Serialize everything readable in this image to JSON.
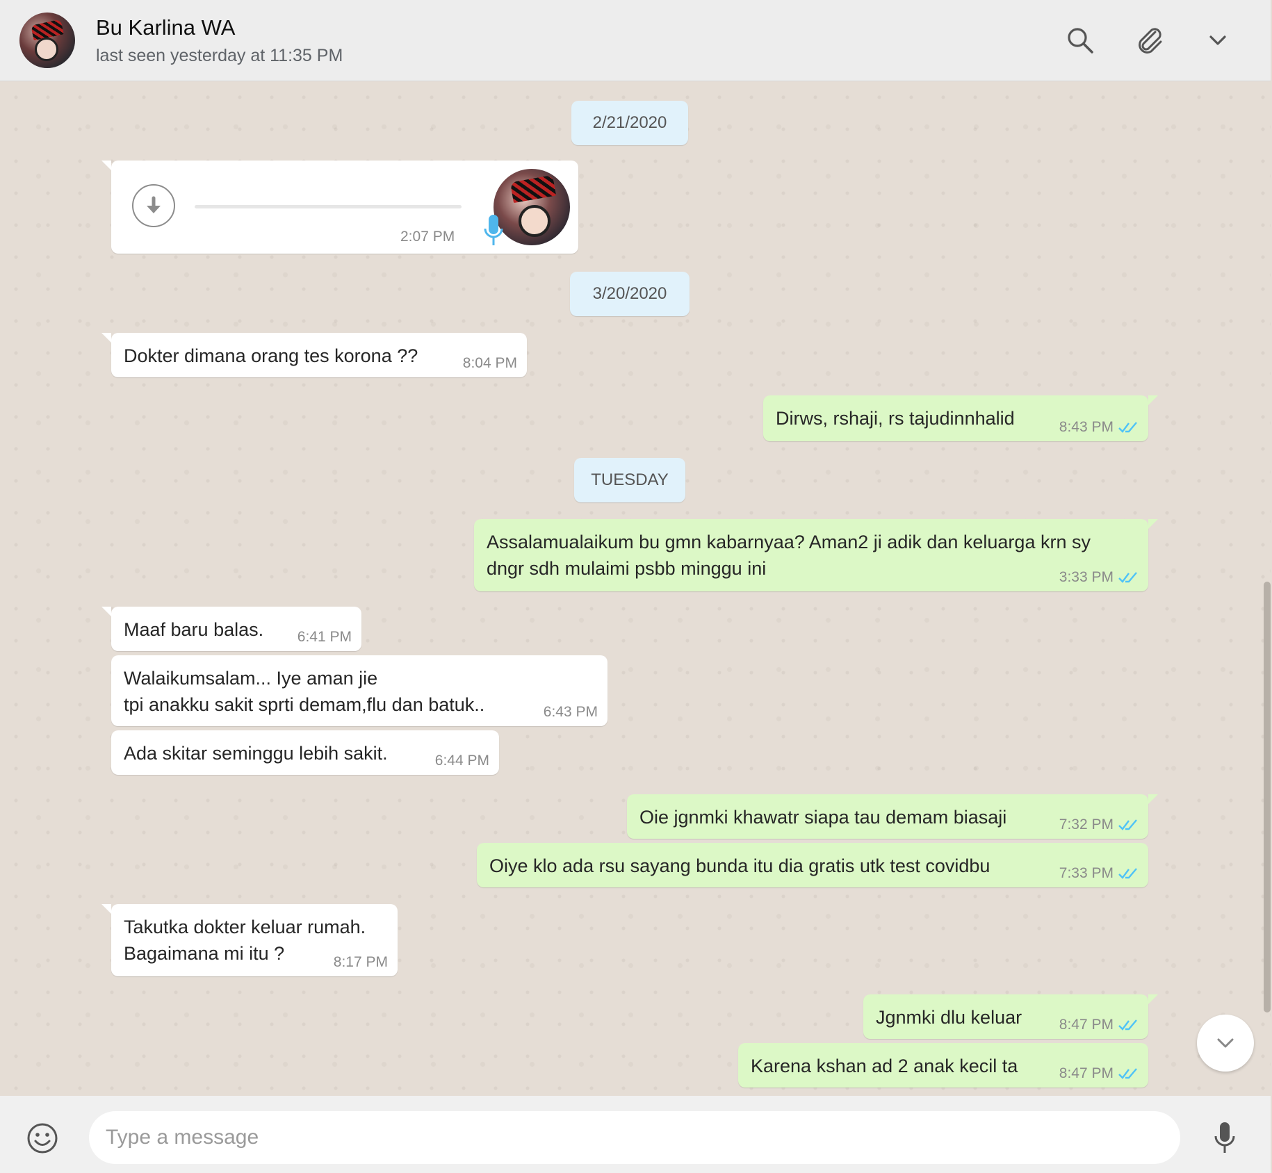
{
  "header": {
    "contact_name": "Bu Karlina WA",
    "status": "last seen yesterday at 11:35 PM",
    "icons": [
      "search-icon",
      "attach-icon",
      "chevron-down-icon"
    ]
  },
  "dates": {
    "d1": "2/21/2020",
    "d2": "3/20/2020",
    "d3": "TUESDAY"
  },
  "voice_message": {
    "time": "2:07 PM",
    "progress": 0
  },
  "messages": [
    {
      "dir": "in",
      "text": "Dokter dimana orang tes korona ??",
      "time": "8:04 PM"
    },
    {
      "dir": "out",
      "text": "Dirws, rshaji, rs tajudinnhalid",
      "time": "8:43 PM"
    },
    {
      "dir": "out",
      "text": "Assalamualaikum bu gmn kabarnyaa? Aman2 ji adik dan keluarga krn sy\ndngr sdh mulaimi psbb minggu ini",
      "time": "3:33 PM"
    },
    {
      "dir": "in",
      "text": "Maaf baru balas.",
      "time": "6:41 PM"
    },
    {
      "dir": "in",
      "text": "Walaikumsalam... Iye aman jie\ntpi anakku sakit sprti demam,flu dan batuk..",
      "time": "6:43 PM"
    },
    {
      "dir": "in",
      "text": "Ada skitar seminggu lebih sakit.",
      "time": "6:44 PM"
    },
    {
      "dir": "out",
      "text": "Oie jgnmki khawatr siapa tau demam biasaji",
      "time": "7:32 PM"
    },
    {
      "dir": "out",
      "text": "Oiye klo ada rsu sayang bunda itu dia gratis utk test covidbu",
      "time": "7:33 PM"
    },
    {
      "dir": "in",
      "text": "Takutka dokter keluar rumah.\nBagaimana mi itu ?",
      "time": "8:17 PM"
    },
    {
      "dir": "out",
      "text": "Jgnmki dlu keluar",
      "time": "8:47 PM"
    },
    {
      "dir": "out",
      "text": "Karena kshan ad 2 anak kecil ta",
      "time": "8:47 PM"
    }
  ],
  "composer": {
    "placeholder": "Type a message",
    "value": ""
  },
  "colors": {
    "incoming_bubble": "#ffffff",
    "outgoing_bubble": "#dcf8c6",
    "date_chip": "#e1f2fb",
    "read_ticks": "#4fc3f7",
    "chat_background": "#e5ddd5"
  }
}
